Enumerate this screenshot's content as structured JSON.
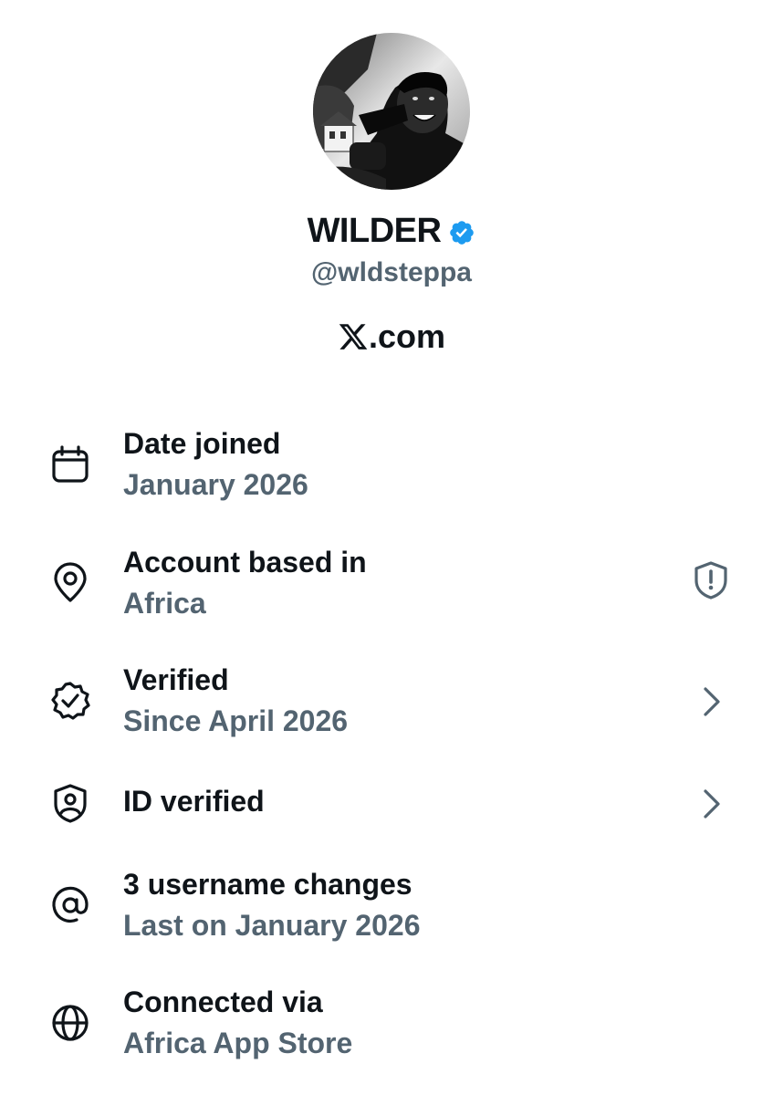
{
  "profile": {
    "avatar_alt": "profile photo",
    "display_name": "WILDER",
    "handle": "@wldsteppa",
    "site": ".com",
    "badge_color": "#1d9bf0"
  },
  "rows": [
    {
      "icon": "calendar-icon",
      "title": "Date joined",
      "subtitle": "January 2026",
      "trailing": ""
    },
    {
      "icon": "location-pin-icon",
      "title": "Account based in",
      "subtitle": "Africa",
      "trailing": "shield-alert-icon"
    },
    {
      "icon": "verified-badge-outline-icon",
      "title": "Verified",
      "subtitle": "Since April 2026",
      "trailing": "chevron-right-icon"
    },
    {
      "icon": "id-shield-icon",
      "title": "ID verified",
      "subtitle": "",
      "trailing": "chevron-right-icon"
    },
    {
      "icon": "at-sign-icon",
      "title": "3 username changes",
      "subtitle": "Last on January 2026",
      "trailing": ""
    },
    {
      "icon": "globe-icon",
      "title": "Connected via",
      "subtitle": "Africa App Store",
      "trailing": ""
    }
  ],
  "colors": {
    "primary_text": "#0f1419",
    "secondary_text": "#536471",
    "accent": "#1d9bf0",
    "background": "#ffffff"
  }
}
